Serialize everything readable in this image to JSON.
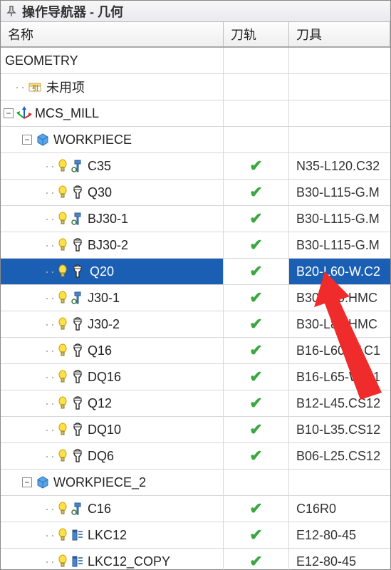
{
  "window": {
    "title": "操作导航器 - 几何"
  },
  "columns": {
    "name": "名称",
    "path": "刀轨",
    "tool": "刀具"
  },
  "tree": {
    "root": "GEOMETRY",
    "unused": "未用项",
    "mcs": "MCS_MILL",
    "wp1": "WORKPIECE",
    "wp2": "WORKPIECE_2"
  },
  "ops1": [
    {
      "name": "C35",
      "tool": "N35-L120.C32",
      "icon": "style-a"
    },
    {
      "name": "Q30",
      "tool": "B30-L115-G.M",
      "icon": "style-b"
    },
    {
      "name": "BJ30-1",
      "tool": "B30-L115-G.M",
      "icon": "style-a"
    },
    {
      "name": "BJ30-2",
      "tool": "B30-L115-G.M",
      "icon": "style-b"
    },
    {
      "name": "Q20",
      "tool": "B20-L60-W.C2",
      "icon": "style-b",
      "selected": true
    },
    {
      "name": "J30-1",
      "tool": "B30-L80.HMC",
      "icon": "style-a"
    },
    {
      "name": "J30-2",
      "tool": "B30-L80.HMC",
      "icon": "style-b"
    },
    {
      "name": "Q16",
      "tool": "B16-L60-W.C1",
      "icon": "style-b"
    },
    {
      "name": "DQ16",
      "tool": "B16-L65-W.C1",
      "icon": "style-b"
    },
    {
      "name": "Q12",
      "tool": "B12-L45.CS12",
      "icon": "style-b"
    },
    {
      "name": "DQ10",
      "tool": "B10-L35.CS12",
      "icon": "style-b"
    },
    {
      "name": "DQ6",
      "tool": "B06-L25.CS12",
      "icon": "style-b"
    }
  ],
  "ops2": [
    {
      "name": "C16",
      "tool": "C16R0",
      "icon": "style-a"
    },
    {
      "name": "LKC12",
      "tool": "E12-80-45",
      "icon": "style-c"
    },
    {
      "name": "LKC12_COPY",
      "tool": "E12-80-45",
      "icon": "style-c"
    }
  ],
  "checkmark": "✔"
}
